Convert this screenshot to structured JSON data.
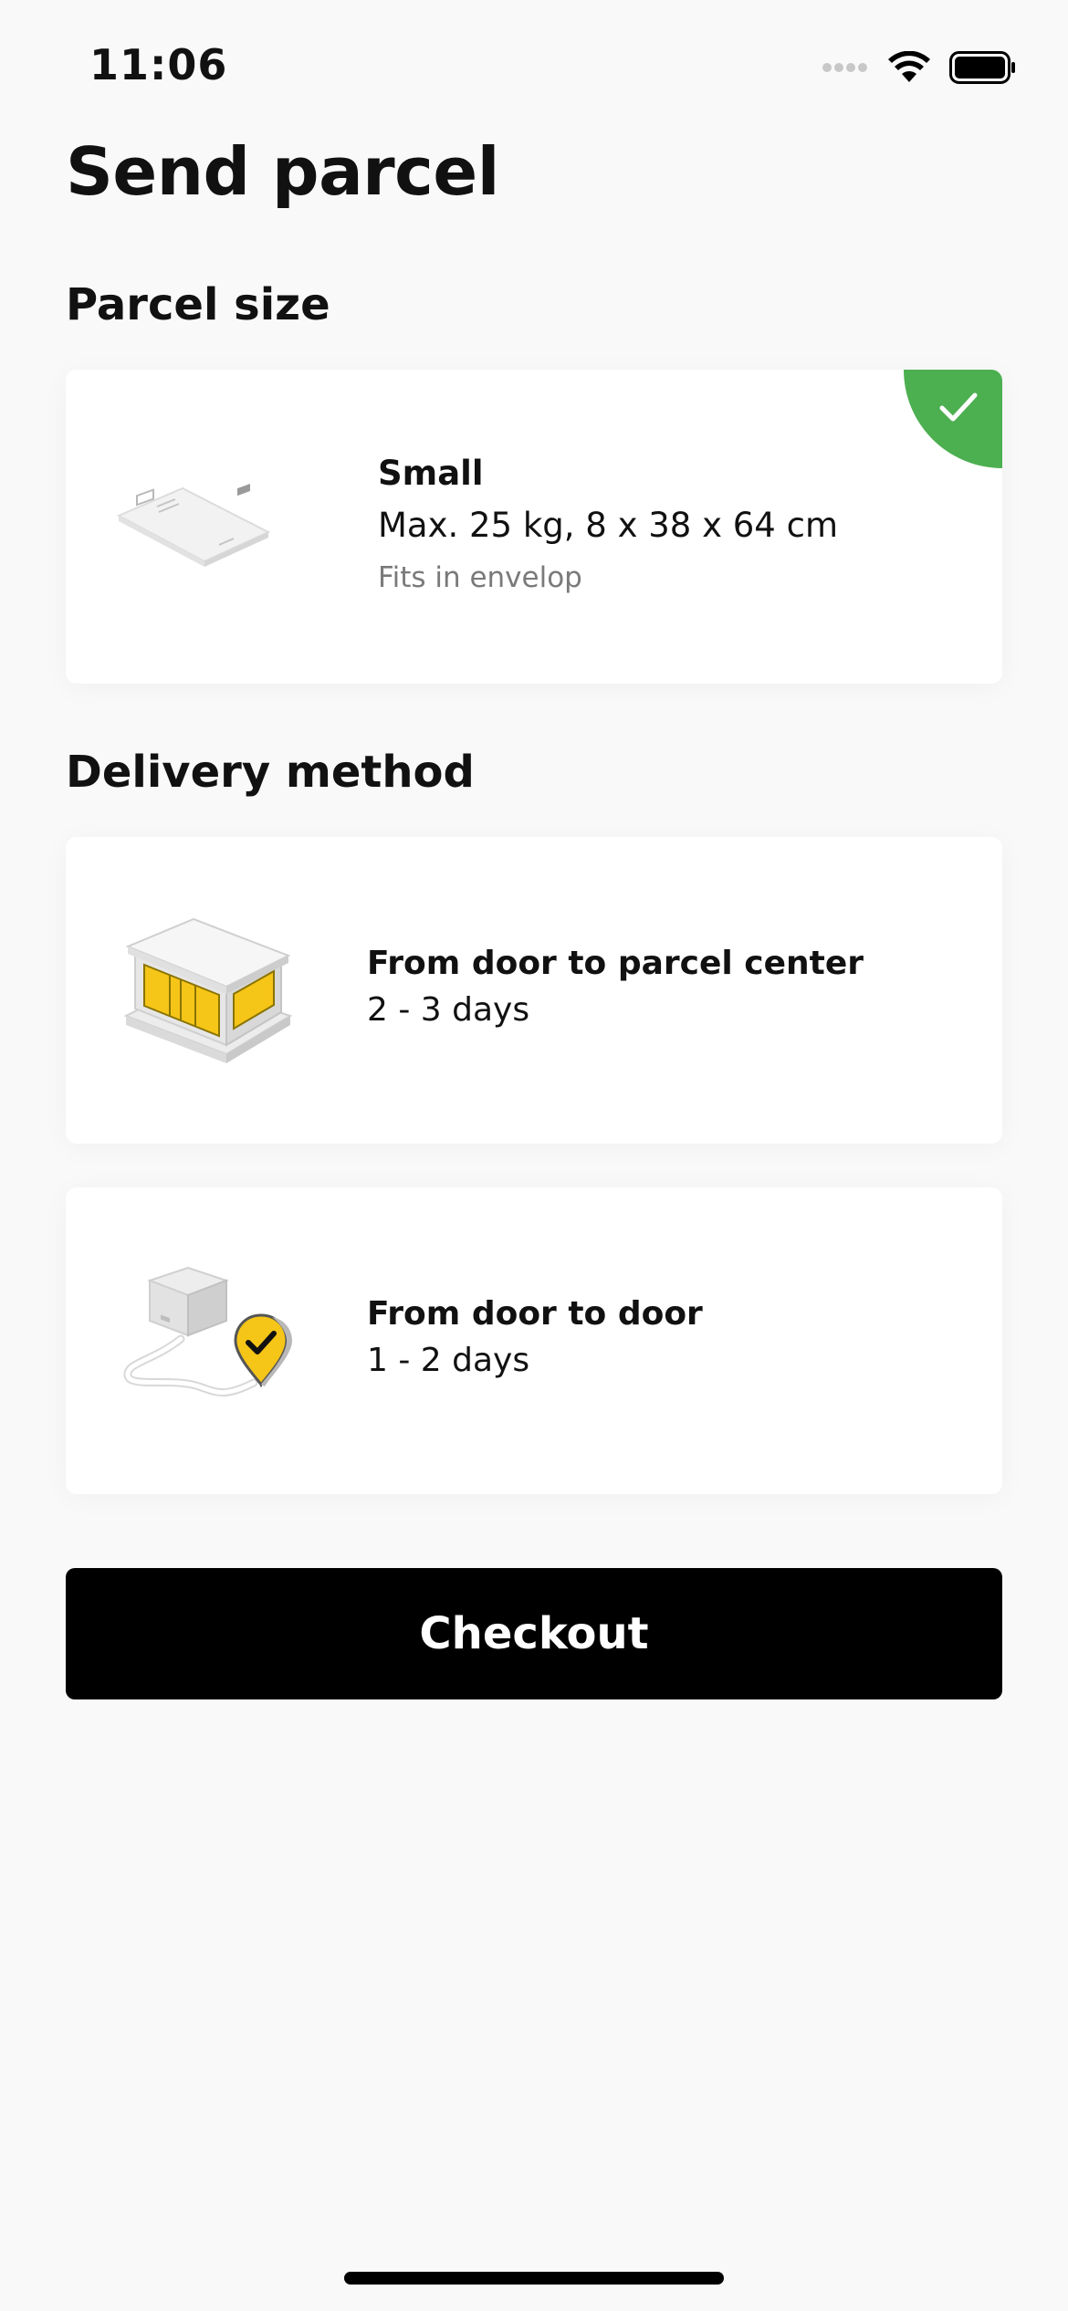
{
  "status_bar": {
    "time": "11:06"
  },
  "page": {
    "title": "Send parcel"
  },
  "parcel_size": {
    "section_title": "Parcel size",
    "selected_option": {
      "name": "Small",
      "dimensions": "Max. 25 kg, 8 x 38 x 64 cm",
      "note": "Fits in envelop",
      "selected": true,
      "illustration": "envelope-parcel-illustration"
    }
  },
  "delivery_method": {
    "section_title": "Delivery method",
    "options": [
      {
        "name": "From door to parcel center",
        "duration": "2 - 3 days",
        "illustration": "parcel-center-illustration"
      },
      {
        "name": "From door to door",
        "duration": "1 - 2 days",
        "illustration": "door-to-door-illustration"
      }
    ]
  },
  "checkout": {
    "label": "Checkout"
  },
  "colors": {
    "background": "#f9f9f9",
    "card": "#ffffff",
    "selected_badge": "#4caf50",
    "primary_button": "#000000",
    "illustration_accent": "#f5c518"
  }
}
